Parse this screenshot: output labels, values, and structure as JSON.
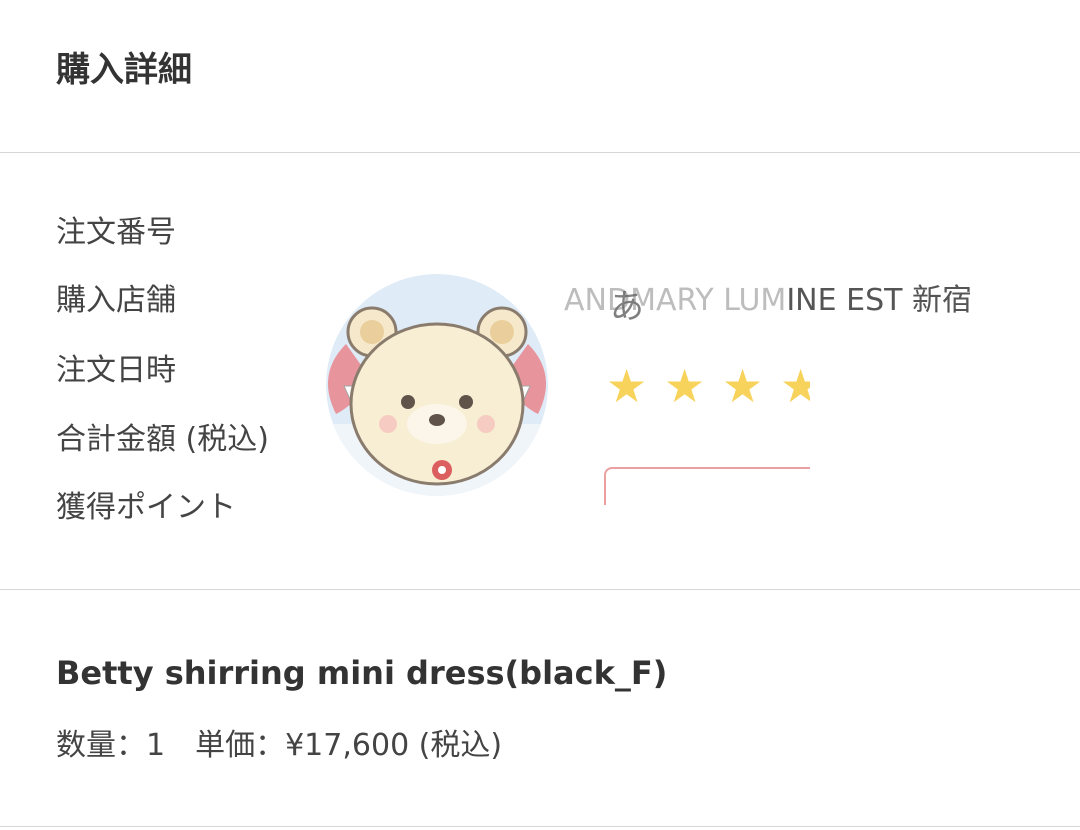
{
  "header": {
    "title": "購入詳細"
  },
  "details": {
    "labels": [
      "注文番号",
      "購入店舗",
      "注文日時",
      "合計金額 (税込)",
      "獲得ポイント"
    ],
    "store": {
      "faded_part": "ANDMARY LUM",
      "visible_part": "INE EST 新宿"
    },
    "overlay": {
      "glyph": "あ",
      "stars": [
        "★",
        "★",
        "★",
        "★"
      ],
      "star_color": "#f7d35c",
      "bubble_color": "#e88f8f",
      "avatar_icon": "bear-character-icon"
    }
  },
  "product": {
    "name": "Betty shirring mini dress(black_F)",
    "quantity": "数量：1",
    "unit_price": "単価：¥17,600 (税込)"
  }
}
